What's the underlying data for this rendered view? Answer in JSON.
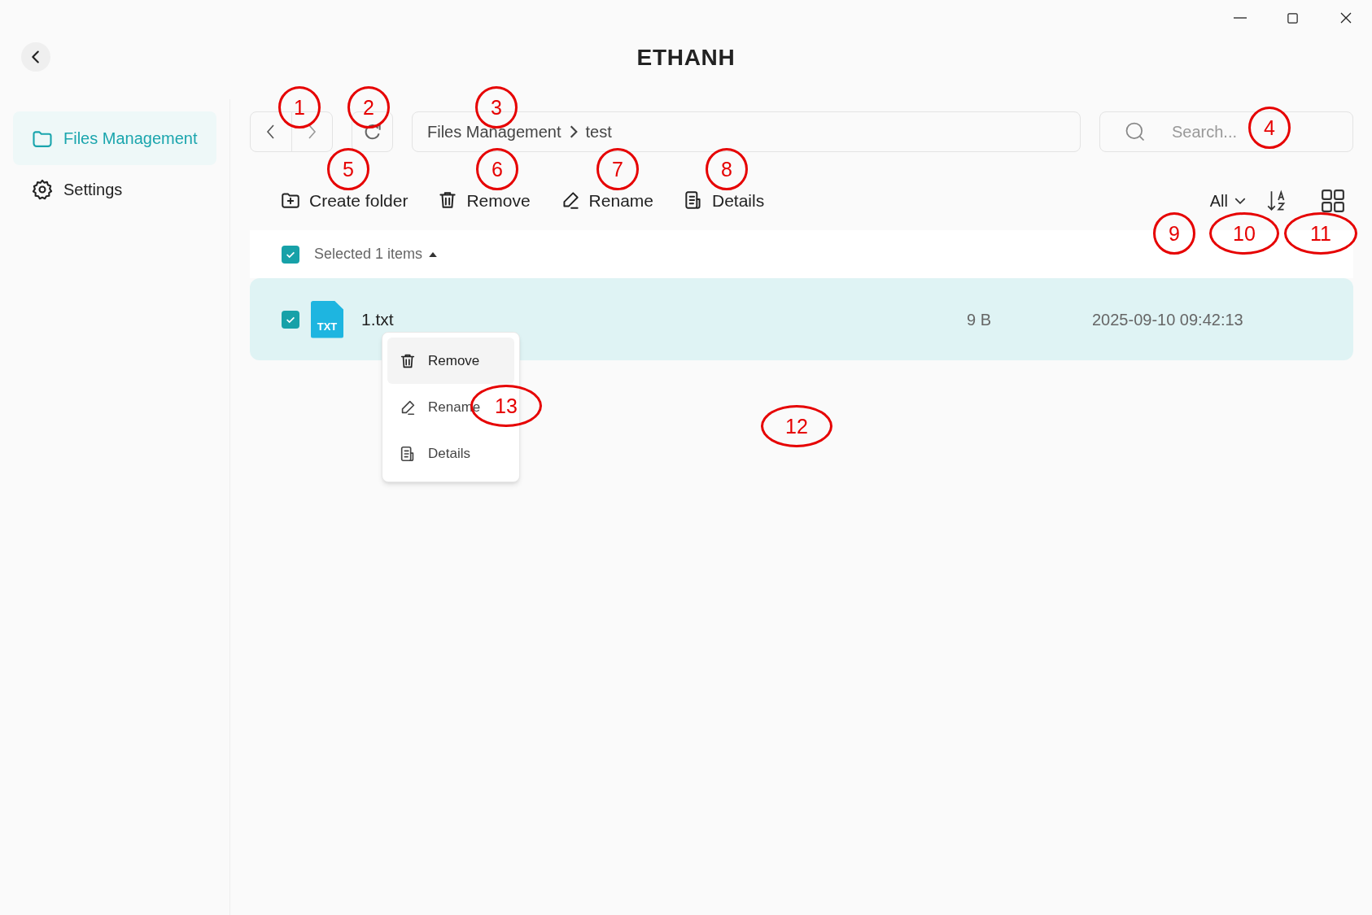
{
  "window": {
    "title": "ETHANH"
  },
  "sidebar": {
    "items": [
      {
        "kind": "folder",
        "label": "Files Management",
        "selected": true
      },
      {
        "kind": "gear",
        "label": "Settings",
        "selected": false
      }
    ]
  },
  "breadcrumb": [
    "Files Management",
    "test"
  ],
  "search": {
    "placeholder": "Search..."
  },
  "toolbar": [
    {
      "kind": "create",
      "label": "Create folder"
    },
    {
      "kind": "remove",
      "label": "Remove"
    },
    {
      "kind": "rename",
      "label": "Rename"
    },
    {
      "kind": "details",
      "label": "Details"
    }
  ],
  "filter": {
    "value": "All"
  },
  "list_header": {
    "checked": true,
    "label": "Selected 1 items"
  },
  "rows": [
    {
      "type_label": "TXT",
      "name": "1.txt",
      "size": "9 B",
      "modified": "2025-09-10 09:42:13",
      "checked": true,
      "selected": true
    }
  ],
  "context_menu": [
    {
      "kind": "remove",
      "label": "Remove",
      "selected": true
    },
    {
      "kind": "rename",
      "label": "Rename",
      "selected": false
    },
    {
      "kind": "details",
      "label": "Details",
      "selected": false
    }
  ],
  "callouts": [
    "1",
    "2",
    "3",
    "4",
    "5",
    "6",
    "7",
    "8",
    "9",
    "10",
    "11",
    "12",
    "13"
  ]
}
